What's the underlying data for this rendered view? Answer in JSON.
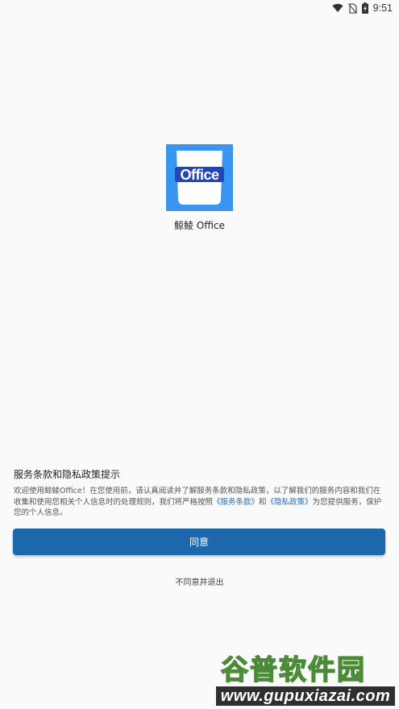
{
  "status_bar": {
    "time": "9:51",
    "icons": [
      "wifi-icon",
      "no-sim-icon",
      "battery-charging-icon"
    ]
  },
  "app": {
    "logo_text": "Office",
    "name": "鲸鲮 Office",
    "logo_color": "#3a95ee"
  },
  "dialog": {
    "title": "服务条款和隐私政策提示",
    "body_part1": "欢迎使用鲸鲮Office！在您使用前，请认真阅读并了解服务条款和隐私政策，以了解我们的服务内容和我们在收集和使用您相关个人信息时的处理规则，我们将严格按照",
    "terms_link": "《服务条款》",
    "body_part2": "和",
    "privacy_link": "《隐私政策》",
    "body_part3": "为您提供服务，保护您的个人信息。",
    "agree_label": "同意",
    "decline_label": "不同意并退出",
    "accent_color": "#1d67ad"
  },
  "watermark": {
    "title": "谷普软件园",
    "url": "www.gupuxiazai.com"
  }
}
